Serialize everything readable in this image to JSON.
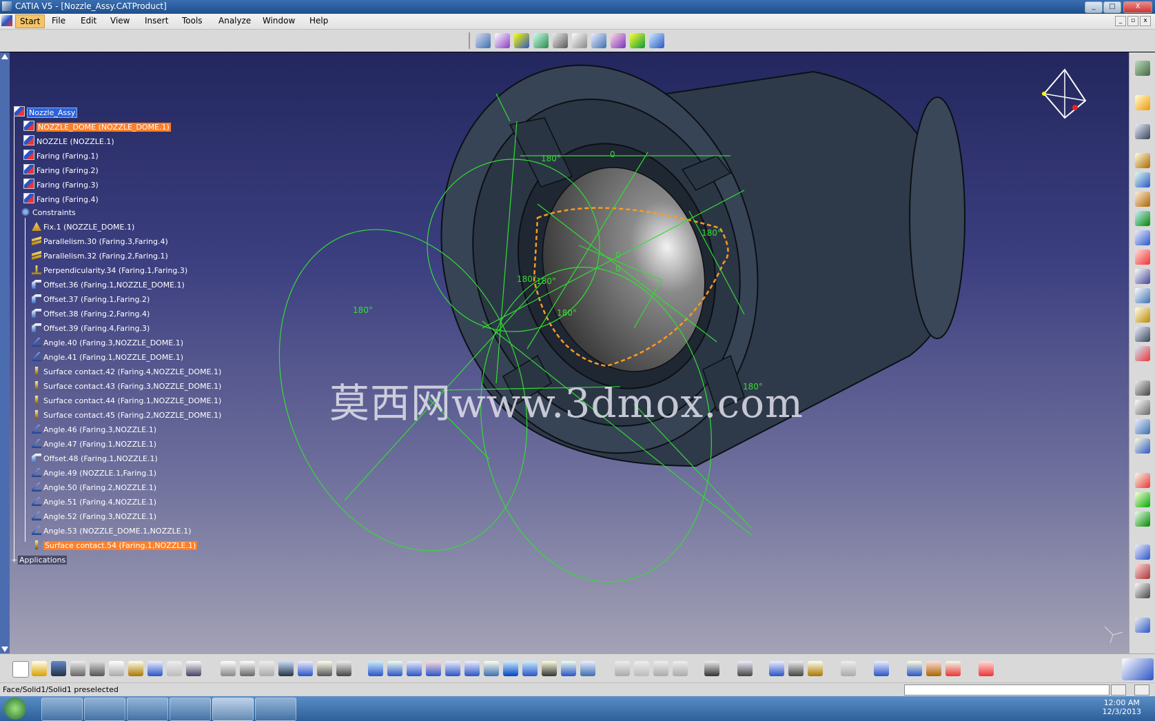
{
  "window": {
    "title": "CATIA V5 - [Nozzle_Assy.CATProduct]",
    "buttons": [
      "_",
      "□",
      "X"
    ]
  },
  "menu": {
    "items": [
      "Start",
      "File",
      "Edit",
      "View",
      "Insert",
      "Tools",
      "Analyze",
      "Window",
      "Help"
    ]
  },
  "tree": {
    "root": "Nozzle_Assy",
    "parts": [
      {
        "label": "NOZZLE_DOME (NOZZLE_DOME.1)",
        "selected": true
      },
      {
        "label": "NOZZLE (NOZZLE.1)"
      },
      {
        "label": "Faring (Faring.1)"
      },
      {
        "label": "Faring (Faring.2)"
      },
      {
        "label": "Faring (Faring.3)"
      },
      {
        "label": "Faring (Faring.4)"
      }
    ],
    "constraints_label": "Constraints",
    "constraints": [
      {
        "label": "Fix.1 (NOZZLE_DOME.1)",
        "icon": "fix-icon"
      },
      {
        "label": "Parallelism.30 (Faring.3,Faring.4)",
        "icon": "parallelism-icon"
      },
      {
        "label": "Parallelism.32 (Faring.2,Faring.1)",
        "icon": "parallelism-icon"
      },
      {
        "label": "Perpendicularity.34 (Faring.1,Faring.3)",
        "icon": "perpendicularity-icon"
      },
      {
        "label": "Offset.36 (Faring.1,NOZZLE_DOME.1)",
        "icon": "offset-icon"
      },
      {
        "label": "Offset.37 (Faring.1,Faring.2)",
        "icon": "offset-icon"
      },
      {
        "label": "Offset.38 (Faring.2,Faring.4)",
        "icon": "offset-icon"
      },
      {
        "label": "Offset.39 (Faring.4,Faring.3)",
        "icon": "offset-icon"
      },
      {
        "label": "Angle.40 (Faring.3,NOZZLE_DOME.1)",
        "icon": "angle-icon"
      },
      {
        "label": "Angle.41 (Faring.1,NOZZLE_DOME.1)",
        "icon": "angle-icon"
      },
      {
        "label": "Surface contact.42 (Faring.4,NOZZLE_DOME.1)",
        "icon": "surface-contact-icon"
      },
      {
        "label": "Surface contact.43 (Faring.3,NOZZLE_DOME.1)",
        "icon": "surface-contact-icon"
      },
      {
        "label": "Surface contact.44 (Faring.1,NOZZLE_DOME.1)",
        "icon": "surface-contact-icon"
      },
      {
        "label": "Surface contact.45 (Faring.2,NOZZLE_DOME.1)",
        "icon": "surface-contact-icon"
      },
      {
        "label": "Angle.46 (Faring.3,NOZZLE.1)",
        "icon": "angle-icon"
      },
      {
        "label": "Angle.47 (Faring.1,NOZZLE.1)",
        "icon": "angle-icon"
      },
      {
        "label": "Offset.48 (Faring.1,NOZZLE.1)",
        "icon": "offset-icon"
      },
      {
        "label": "Angle.49 (NOZZLE.1,Faring.1)",
        "icon": "angle-icon"
      },
      {
        "label": "Angle.50 (Faring.2,NOZZLE.1)",
        "icon": "angle-icon"
      },
      {
        "label": "Angle.51 (Faring.4,NOZZLE.1)",
        "icon": "angle-icon"
      },
      {
        "label": "Angle.52 (Faring.3,NOZZLE.1)",
        "icon": "angle-icon"
      },
      {
        "label": "Angle.53 (NOZZLE_DOME.1,NOZZLE.1)",
        "icon": "angle-icon"
      },
      {
        "label": "Surface contact.54 (Faring.1,NOZZLE.1)",
        "icon": "surface-contact-icon",
        "selected": true
      }
    ],
    "applications_label": "Applications"
  },
  "viewport": {
    "watermark": "莫西网www.3dmox.com",
    "angle_labels": [
      "180°",
      "0",
      "180°",
      "180°",
      "180°",
      "180°",
      "180°",
      "0",
      "0",
      "180°"
    ]
  },
  "status": {
    "message": "Face/Solid1/Solid1 preselected"
  },
  "taskbar": {
    "time": "12:00 AM",
    "date": "12/3/2013"
  },
  "colors": {
    "selection": "#ff7f27",
    "root_highlight": "#2b62d9",
    "constraint_green": "#33dd33",
    "contact_orange": "#ff9a20"
  }
}
